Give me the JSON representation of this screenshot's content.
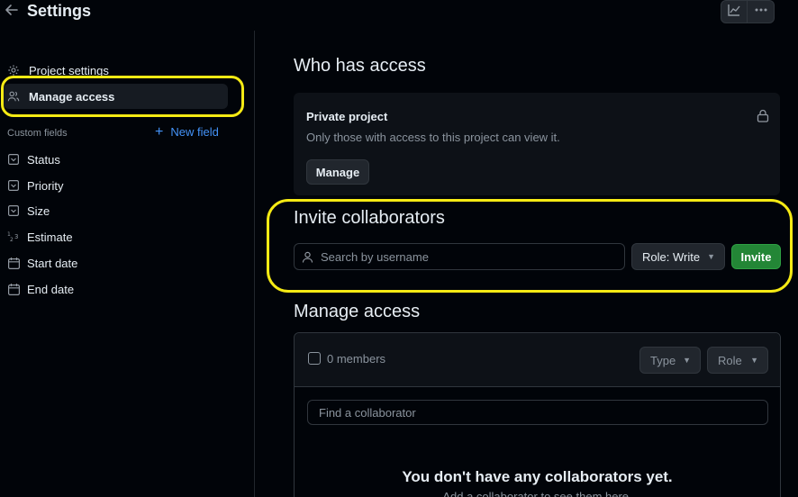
{
  "header": {
    "title": "Settings",
    "back_icon": "arrow-left-icon",
    "buttons": [
      "insights-graph-icon",
      "kebab-horizontal-icon"
    ]
  },
  "sidebar": {
    "items": [
      {
        "label": "Project settings",
        "icon": "gear-icon"
      },
      {
        "label": "Manage access",
        "icon": "people-icon",
        "active": true
      }
    ],
    "custom_fields_label": "Custom fields",
    "new_field_label": "New field",
    "fields": [
      {
        "label": "Status",
        "icon": "single-select-icon"
      },
      {
        "label": "Priority",
        "icon": "single-select-icon"
      },
      {
        "label": "Size",
        "icon": "single-select-icon"
      },
      {
        "label": "Estimate",
        "icon": "number-icon"
      },
      {
        "label": "Start date",
        "icon": "calendar-icon"
      },
      {
        "label": "End date",
        "icon": "calendar-icon"
      }
    ]
  },
  "who_has_access": {
    "heading": "Who has access",
    "title": "Private project",
    "description": "Only those with access to this project can view it.",
    "manage_button": "Manage"
  },
  "invite": {
    "heading": "Invite collaborators",
    "search_placeholder": "Search by username",
    "role_button": "Role: Write",
    "invite_button": "Invite"
  },
  "manage_access": {
    "heading": "Manage access",
    "members_count": "0 members",
    "type_filter": "Type",
    "role_filter": "Role",
    "find_placeholder": "Find a collaborator",
    "empty_title": "You don't have any collaborators yet.",
    "empty_description": "Add a collaborator to see them here."
  },
  "colors": {
    "background": "#010409",
    "panel": "#0d1117",
    "accent_link": "#4493f8",
    "invite_green": "#238636",
    "highlight_yellow": "#f5ea14"
  }
}
